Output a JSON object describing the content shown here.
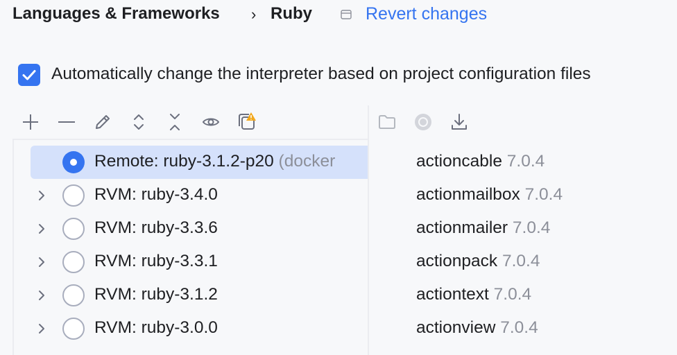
{
  "breadcrumb": {
    "section": "Languages & Frameworks",
    "separator": "›",
    "page": "Ruby",
    "revert_label": "Revert changes"
  },
  "auto_interpreter": {
    "checked": true,
    "label": "Automatically change the interpreter based on project configuration files"
  },
  "toolbar": {
    "left": [
      "plus-icon",
      "minus-icon",
      "edit-pencil-icon",
      "expand-all-icon",
      "collapse-all-icon",
      "eye-icon",
      "copy-warning-icon"
    ],
    "right": [
      "folder-icon",
      "circle-icon",
      "download-icon"
    ]
  },
  "interpreters": [
    {
      "label": "Remote: ruby-3.1.2-p20",
      "extra": " (docker",
      "selected": true,
      "expandable": false
    },
    {
      "label": "RVM: ruby-3.4.0",
      "extra": "",
      "selected": false,
      "expandable": true
    },
    {
      "label": "RVM: ruby-3.3.6",
      "extra": "",
      "selected": false,
      "expandable": true
    },
    {
      "label": "RVM: ruby-3.3.1",
      "extra": "",
      "selected": false,
      "expandable": true
    },
    {
      "label": "RVM: ruby-3.1.2",
      "extra": "",
      "selected": false,
      "expandable": true
    },
    {
      "label": "RVM: ruby-3.0.0",
      "extra": "",
      "selected": false,
      "expandable": true
    }
  ],
  "gems": [
    {
      "name": "actioncable",
      "version": " 7.0.4"
    },
    {
      "name": "actionmailbox",
      "version": " 7.0.4"
    },
    {
      "name": "actionmailer",
      "version": " 7.0.4"
    },
    {
      "name": "actionpack",
      "version": " 7.0.4"
    },
    {
      "name": "actiontext",
      "version": " 7.0.4"
    },
    {
      "name": "actionview",
      "version": " 7.0.4"
    }
  ],
  "colors": {
    "accent": "#3574f0",
    "selection": "#d5e1fb",
    "muted_text": "#8c8f99",
    "warning": "#f2a81d"
  }
}
